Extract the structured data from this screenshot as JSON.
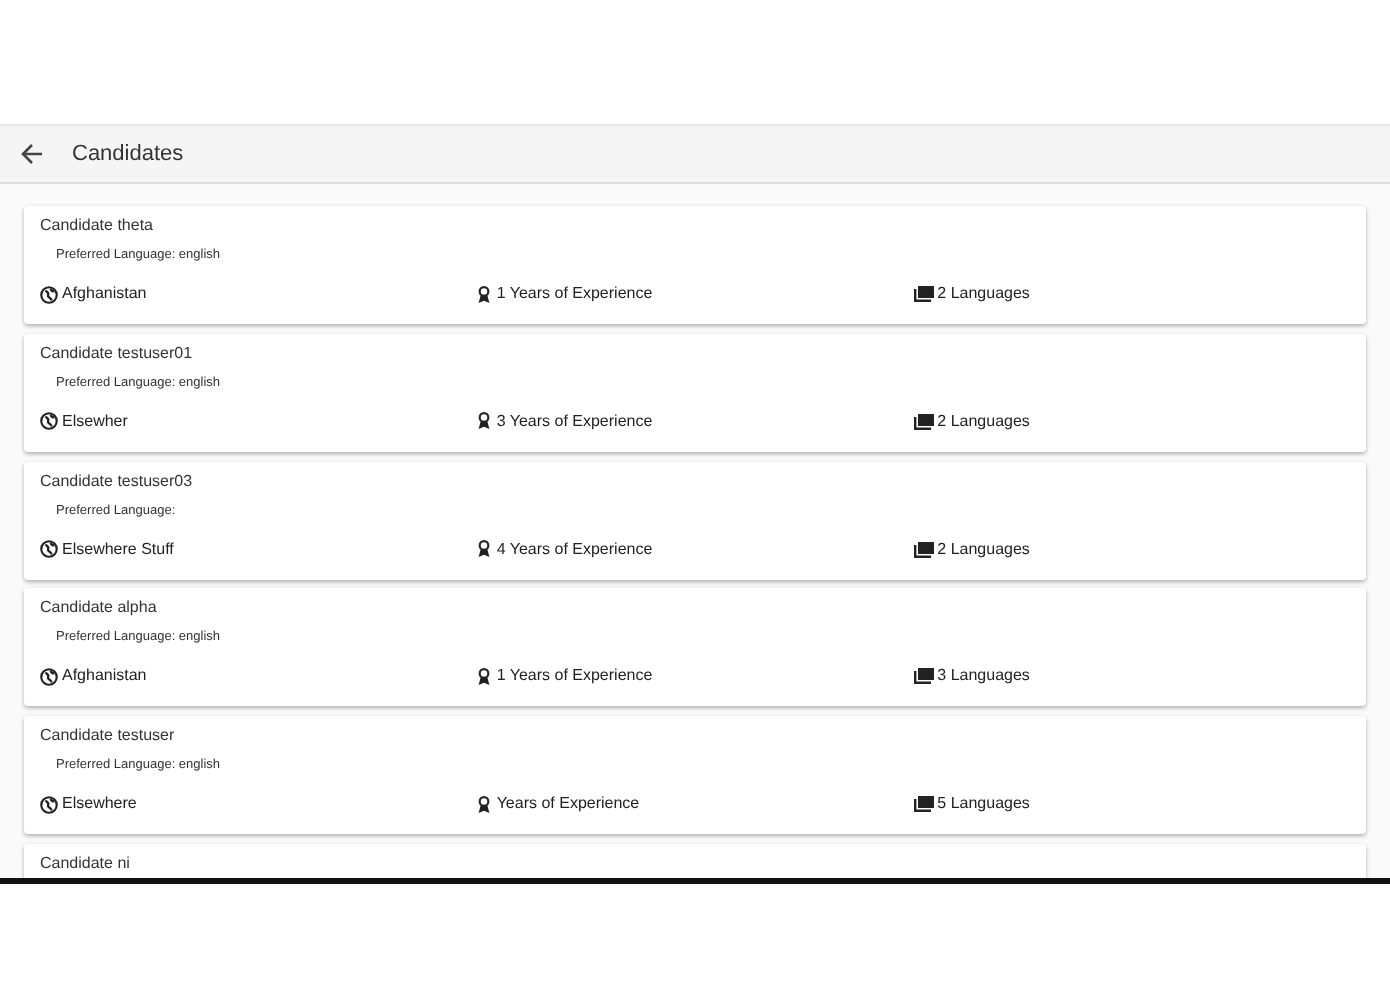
{
  "header": {
    "title": "Candidates"
  },
  "candidates": [
    {
      "name": "Candidate theta",
      "preferred_language": "Preferred Language: english",
      "location": "Afghanistan",
      "experience": "1 Years of Experience",
      "languages": "2 Languages"
    },
    {
      "name": "Candidate testuser01",
      "preferred_language": "Preferred Language: english",
      "location": "Elsewher",
      "experience": "3 Years of Experience",
      "languages": "2 Languages"
    },
    {
      "name": "Candidate testuser03",
      "preferred_language": "Preferred Language:",
      "location": "Elsewhere Stuff",
      "experience": "4 Years of Experience",
      "languages": "2 Languages"
    },
    {
      "name": "Candidate alpha",
      "preferred_language": "Preferred Language: english",
      "location": "Afghanistan",
      "experience": "1 Years of Experience",
      "languages": "3 Languages"
    },
    {
      "name": "Candidate testuser",
      "preferred_language": "Preferred Language: english",
      "location": "Elsewhere",
      "experience": "Years of Experience",
      "languages": "5 Languages"
    },
    {
      "name": "Candidate ni"
    }
  ]
}
